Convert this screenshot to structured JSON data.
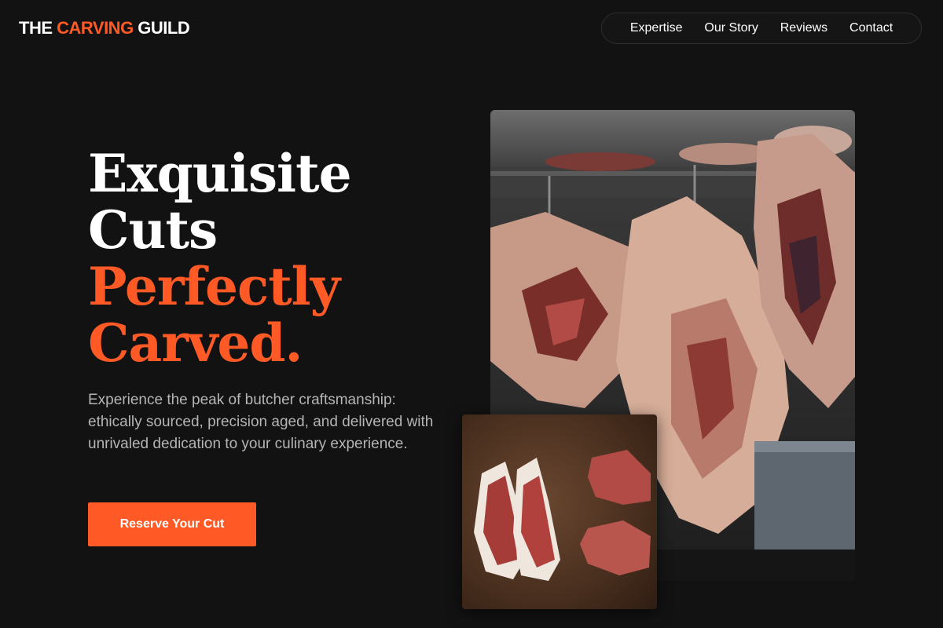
{
  "brand": {
    "logo_part1": "THE ",
    "logo_accent": "CARVING",
    "logo_part2": " GUILD",
    "accent_color": "#ff5a26"
  },
  "nav": {
    "items": [
      {
        "label": "Expertise"
      },
      {
        "label": "Our Story"
      },
      {
        "label": "Reviews"
      },
      {
        "label": "Contact"
      }
    ]
  },
  "hero": {
    "headline_line1": "Exquisite",
    "headline_line2": "Cuts",
    "headline_line3": "Perfectly",
    "headline_line4": "Carved.",
    "subtext": "Experience the peak of butcher craftsmanship: ethically sourced, precision aged, and delivered with unrivaled dedication to your culinary experience.",
    "cta_label": "Reserve Your Cut"
  },
  "images": {
    "main_alt": "hanging-beef-icon",
    "secondary_alt": "steaks-on-board-icon"
  }
}
